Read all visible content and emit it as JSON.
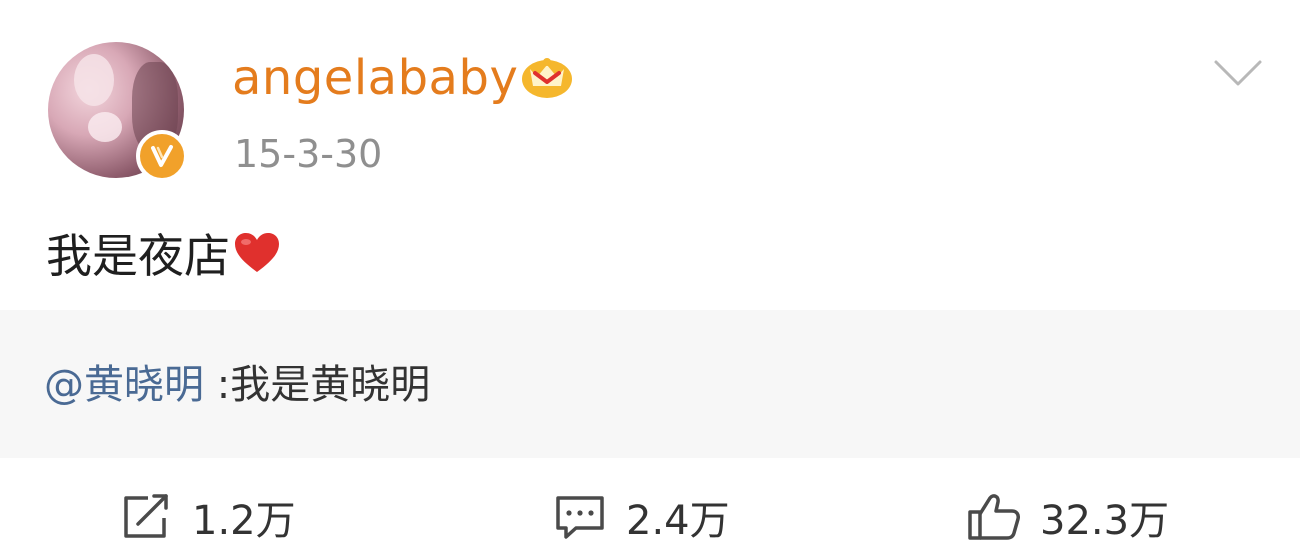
{
  "post": {
    "username": "angelababy",
    "timestamp": "15-3-30",
    "text": "我是夜店",
    "quoted": {
      "mention": "@黄晓明",
      "text": " :我是黄晓明"
    }
  },
  "actions": {
    "repost_count": "1.2万",
    "comment_count": "2.4万",
    "like_count": "32.3万"
  },
  "icons": {
    "avatar": "avatar",
    "verified": "verified-badge-icon",
    "vip": "crown-vip-icon",
    "menu": "chevron-down-icon",
    "heart": "heart-icon",
    "repost": "repost-icon",
    "comment": "comment-icon",
    "like": "thumbs-up-icon"
  },
  "colors": {
    "username": "#e47c1d",
    "mention": "#4a6a94",
    "heart": "#e0302d",
    "badge": "#f1a12a"
  }
}
